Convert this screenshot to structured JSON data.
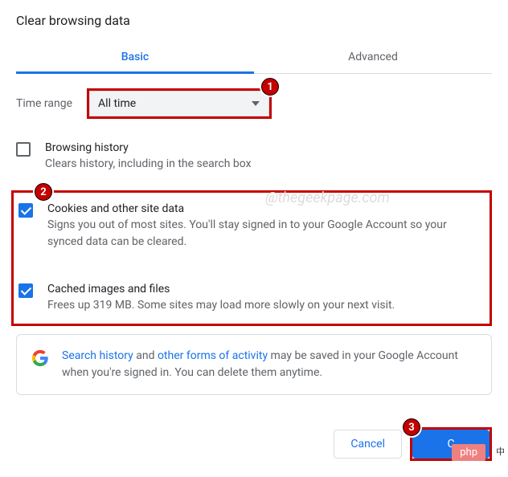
{
  "title": "Clear browsing data",
  "tabs": {
    "basic": "Basic",
    "advanced": "Advanced"
  },
  "timeRange": {
    "label": "Time range",
    "value": "All time"
  },
  "options": {
    "browsing": {
      "title": "Browsing history",
      "desc": "Clears history, including in the search box",
      "checked": false
    },
    "cookies": {
      "title": "Cookies and other site data",
      "desc": "Signs you out of most sites. You'll stay signed in to your Google Account so your synced data can be cleared.",
      "checked": true
    },
    "cache": {
      "title": "Cached images and files",
      "desc": "Frees up 319 MB. Some sites may load more slowly on your next visit.",
      "checked": true
    }
  },
  "info": {
    "link1": "Search history",
    "mid1": " and ",
    "link2": "other forms of activity",
    "rest": " may be saved in your Google Account when you're signed in. You can delete them anytime."
  },
  "buttons": {
    "cancel": "Cancel",
    "clear": "C"
  },
  "watermark": "@thegeekpage.com",
  "badges": {
    "b1": "1",
    "b2": "2",
    "b3": "3"
  },
  "overlay": {
    "php": "php",
    "cn": "中"
  }
}
